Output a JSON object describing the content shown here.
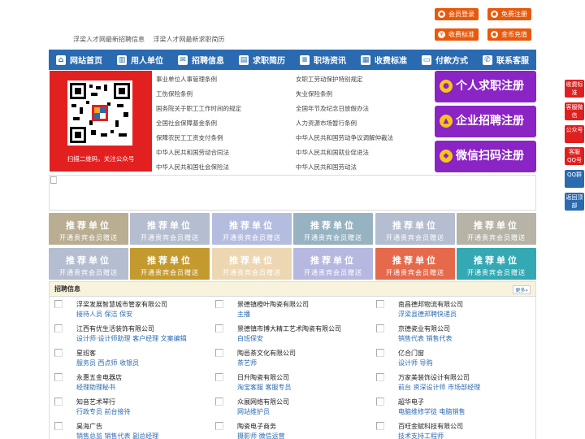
{
  "top_buttons": [
    {
      "label": "会员登录",
      "icon": "user-icon"
    },
    {
      "label": "免费注册",
      "icon": "register-icon"
    },
    {
      "label": "收费标准",
      "icon": "yen-icon"
    },
    {
      "label": "金币充值",
      "icon": "coin-icon"
    }
  ],
  "site_links": [
    "浮梁人才网最新招聘信息",
    "浮梁人才网最新求职简历"
  ],
  "nav": [
    {
      "label": "网站首页",
      "icon": "home-icon",
      "glyph": "⌂"
    },
    {
      "label": "用人单位",
      "icon": "building-icon",
      "glyph": "▥"
    },
    {
      "label": "招聘信息",
      "icon": "chat-icon",
      "glyph": "✉"
    },
    {
      "label": "求职简历",
      "icon": "resume-icon",
      "glyph": "▤"
    },
    {
      "label": "职场资讯",
      "icon": "news-icon",
      "glyph": "≡"
    },
    {
      "label": "收费标准",
      "icon": "fee-icon",
      "glyph": "▦"
    },
    {
      "label": "付款方式",
      "icon": "card-icon",
      "glyph": "▭"
    },
    {
      "label": "联系客服",
      "icon": "phone-icon",
      "glyph": "✆"
    }
  ],
  "qr_caption": "扫描二维码，关注公众号",
  "laws_left": [
    "事业单位人事管理条例",
    "工伤保险条例",
    "国务院关于职工工作时间的规定",
    "全国社会保障基金条例",
    "保障农民工工资支付条例",
    "中华人民共和国劳动合同法",
    "中华人民共和国社会保险法"
  ],
  "laws_right": [
    "女职工劳动保护特别规定",
    "失业保险条例",
    "全国年节及纪念日放假办法",
    "人力资源市场暂行条例",
    "中华人民共和国劳动争议调解仲裁法",
    "中华人民共和国就业促进法",
    "中华人民共和国劳动法"
  ],
  "register": [
    {
      "label": "个人求职注册",
      "icon": "person-icon"
    },
    {
      "label": "企业招聘注册",
      "icon": "company-icon"
    },
    {
      "label": "微信扫码注册",
      "icon": "wechat-icon"
    }
  ],
  "recommend": {
    "title": "推荐单位",
    "subtitle": "开通贵宾会员赠送"
  },
  "recommend_colors": [
    "#b9ad92",
    "#b4bed0",
    "#b4bde0",
    "#97b3c2",
    "#b4bed0",
    "#b7b3a7",
    "#b4bed0",
    "#c49a2e",
    "#ecd7b2",
    "#b7b8e0",
    "#e56a4c",
    "#34a9b3",
    "#cdbab0",
    "#b9bcc9"
  ],
  "jobs": {
    "title": "招聘信息",
    "more": "更多»",
    "columns": [
      [
        {
          "company": "浮梁发展智慧城市管家有限公司",
          "positions": "接待人员 保洁 保安"
        },
        {
          "company": "江西有优生活装饰有限公司",
          "positions": "设计师·设计师助理 客户经理 文案编辑"
        },
        {
          "company": "星班客",
          "positions": "服务员 西点师 收银员"
        },
        {
          "company": "永惠五金电器店",
          "positions": "经理助理秘书"
        },
        {
          "company": "知音艺术琴行",
          "positions": "行政专员 前台接待"
        },
        {
          "company": "昊海广告",
          "positions": "销售总监 销售代表 副总经理"
        }
      ],
      [
        {
          "company": "景德镇橙叶陶瓷有限公司",
          "positions": "主播"
        },
        {
          "company": "景德镇市博大精工艺术陶瓷有限公司",
          "positions": "白班保安"
        },
        {
          "company": "陶邑茶文化有限公司",
          "positions": "茶艺师"
        },
        {
          "company": "日升陶瓷有限公司",
          "positions": "淘宝客服 客服专员"
        },
        {
          "company": "众展网络有限公司",
          "positions": "网站维护员"
        },
        {
          "company": "陶瓷电子商务",
          "positions": "摄影师 微信运营"
        }
      ],
      [
        {
          "company": "南昌德邦物流有限公司",
          "positions": "浮梁县德邦聘快递员"
        },
        {
          "company": "京德瓷业有限公司",
          "positions": "销售代表 销售代表"
        },
        {
          "company": "亿合门窗",
          "positions": "设计师 导购"
        },
        {
          "company": "万家美装饰设计有限公司",
          "positions": "前台 资深设计师 市场部经理"
        },
        {
          "company": "超华电子",
          "positions": "电脑维修学徒 电脑销售"
        },
        {
          "company": "百旺金赋科技有限公司",
          "positions": "技术支持工程师"
        }
      ]
    ]
  },
  "sidebar": [
    {
      "label": "收费标准",
      "color": "#e0201f"
    },
    {
      "label": "客服微信",
      "color": "#e0201f"
    },
    {
      "label": "公众号",
      "color": "#e0201f"
    },
    {
      "label": "客服QQ号",
      "color": "#e0201f"
    },
    {
      "label": "QQ群",
      "color": "#2a6ab0"
    },
    {
      "label": "返回顶部",
      "color": "#2a6ab0"
    }
  ]
}
